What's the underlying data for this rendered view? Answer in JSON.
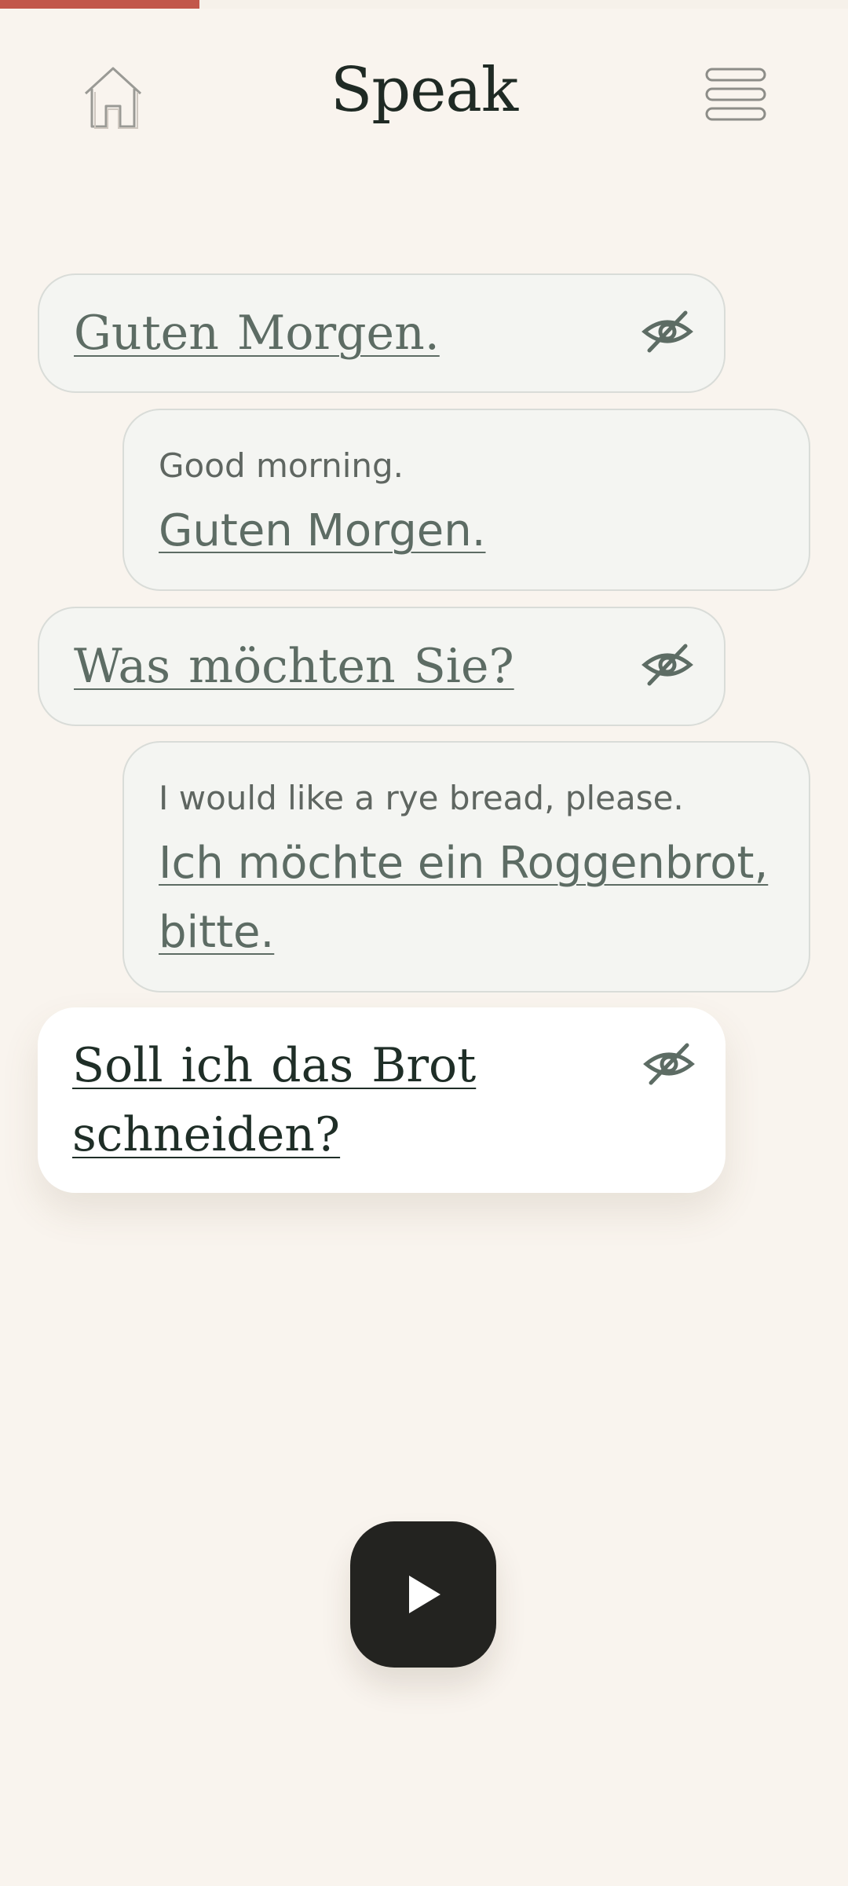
{
  "progress": {
    "fraction": 0.235,
    "color": "#c2574a"
  },
  "header": {
    "title": "Speak",
    "home_icon": "home-icon",
    "menu_icon": "menu-icon"
  },
  "conversation": [
    {
      "role": "prompt",
      "german": "Guten Morgen.",
      "icon": "eye-slash-icon",
      "state": "read"
    },
    {
      "role": "reply",
      "translation": "Good morning.",
      "german": "Guten Morgen."
    },
    {
      "role": "prompt",
      "german": "Was möchten Sie?",
      "icon": "eye-slash-icon",
      "state": "read"
    },
    {
      "role": "reply",
      "translation": "I would like a rye bread, please.",
      "german": "Ich möchte ein Roggenbrot, bitte."
    },
    {
      "role": "prompt",
      "german": "Soll ich das Brot schneiden?",
      "icon": "eye-slash-icon",
      "state": "active"
    }
  ],
  "controls": {
    "play_icon": "play-icon"
  },
  "colors": {
    "background": "#f9f4ee",
    "accent": "#c2574a",
    "play_button": "#232320",
    "muted_text": "#5d6c64",
    "active_text": "#1f2e27"
  }
}
